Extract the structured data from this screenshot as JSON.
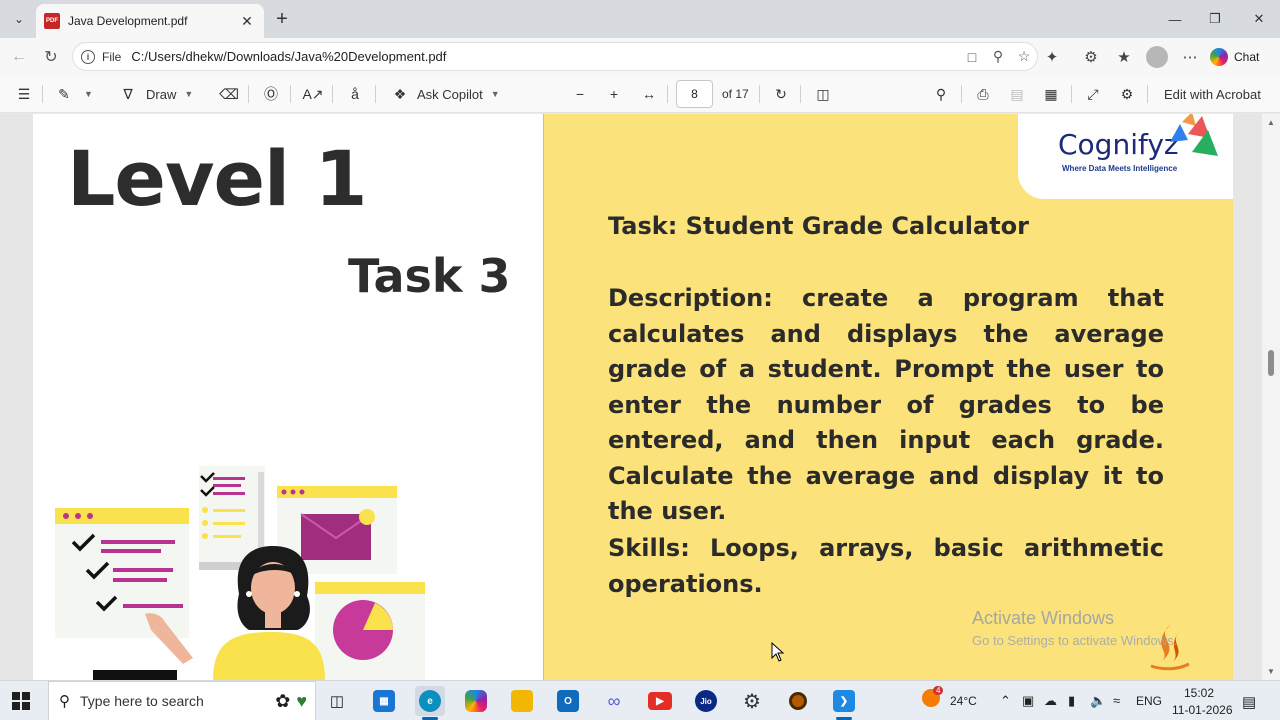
{
  "browser": {
    "tab_title": "Java Development.pdf",
    "tab_icon_label": "PDF",
    "address_prefix": "File",
    "url": "C:/Users/dhekw/Downloads/Java%20Development.pdf",
    "chat_label": "Chat"
  },
  "pdf_toolbar": {
    "draw_label": "Draw",
    "ask_copilot_label": "Ask Copilot",
    "current_page": "8",
    "total_pages": "of 17",
    "edit_label": "Edit with Acrobat"
  },
  "document": {
    "level_title": "Level 1",
    "task_number": "Task 3",
    "logo_name": "Cognifyz",
    "logo_tagline": "Where Data Meets Intelligence",
    "task_heading": "Task: Student Grade Calculator",
    "description": "Description: create a program that calculates and displays the average grade of a student. Prompt the user to enter the number of grades to be entered, and then input each grade. Calculate the average and display it to the user.",
    "skills": "Skills: Loops, arrays, basic arithmetic operations.",
    "watermark_title": "Activate Windows",
    "watermark_sub": "Go to Settings to activate Windows."
  },
  "taskbar": {
    "search_placeholder": "Type here to search",
    "weather_temp": "24°C",
    "weather_badge": "4",
    "language": "ENG",
    "time": "15:02",
    "date": "11-01-2026",
    "jio_label": "Jio"
  },
  "colors": {
    "page_yellow": "#fbe27a",
    "accent_magenta": "#b8328f",
    "logo_navy": "#1e2a78"
  }
}
